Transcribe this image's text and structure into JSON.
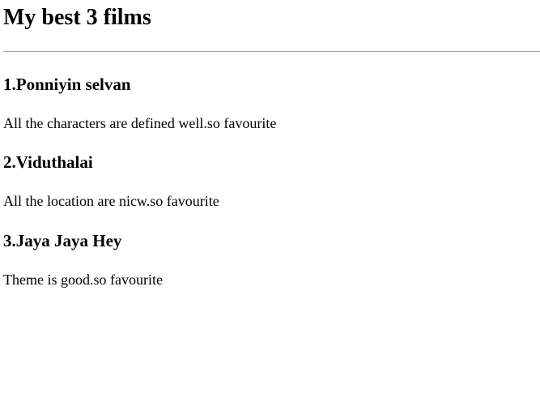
{
  "page": {
    "title": "My best 3 films"
  },
  "films": [
    {
      "title": "1.Ponniyin selvan",
      "description": "All the characters are defined well.so favourite"
    },
    {
      "title": "2.Viduthalai",
      "description": "All the location are nicw.so favourite"
    },
    {
      "title": "3.Jaya Jaya Hey",
      "description": "Theme is good.so favourite"
    }
  ]
}
